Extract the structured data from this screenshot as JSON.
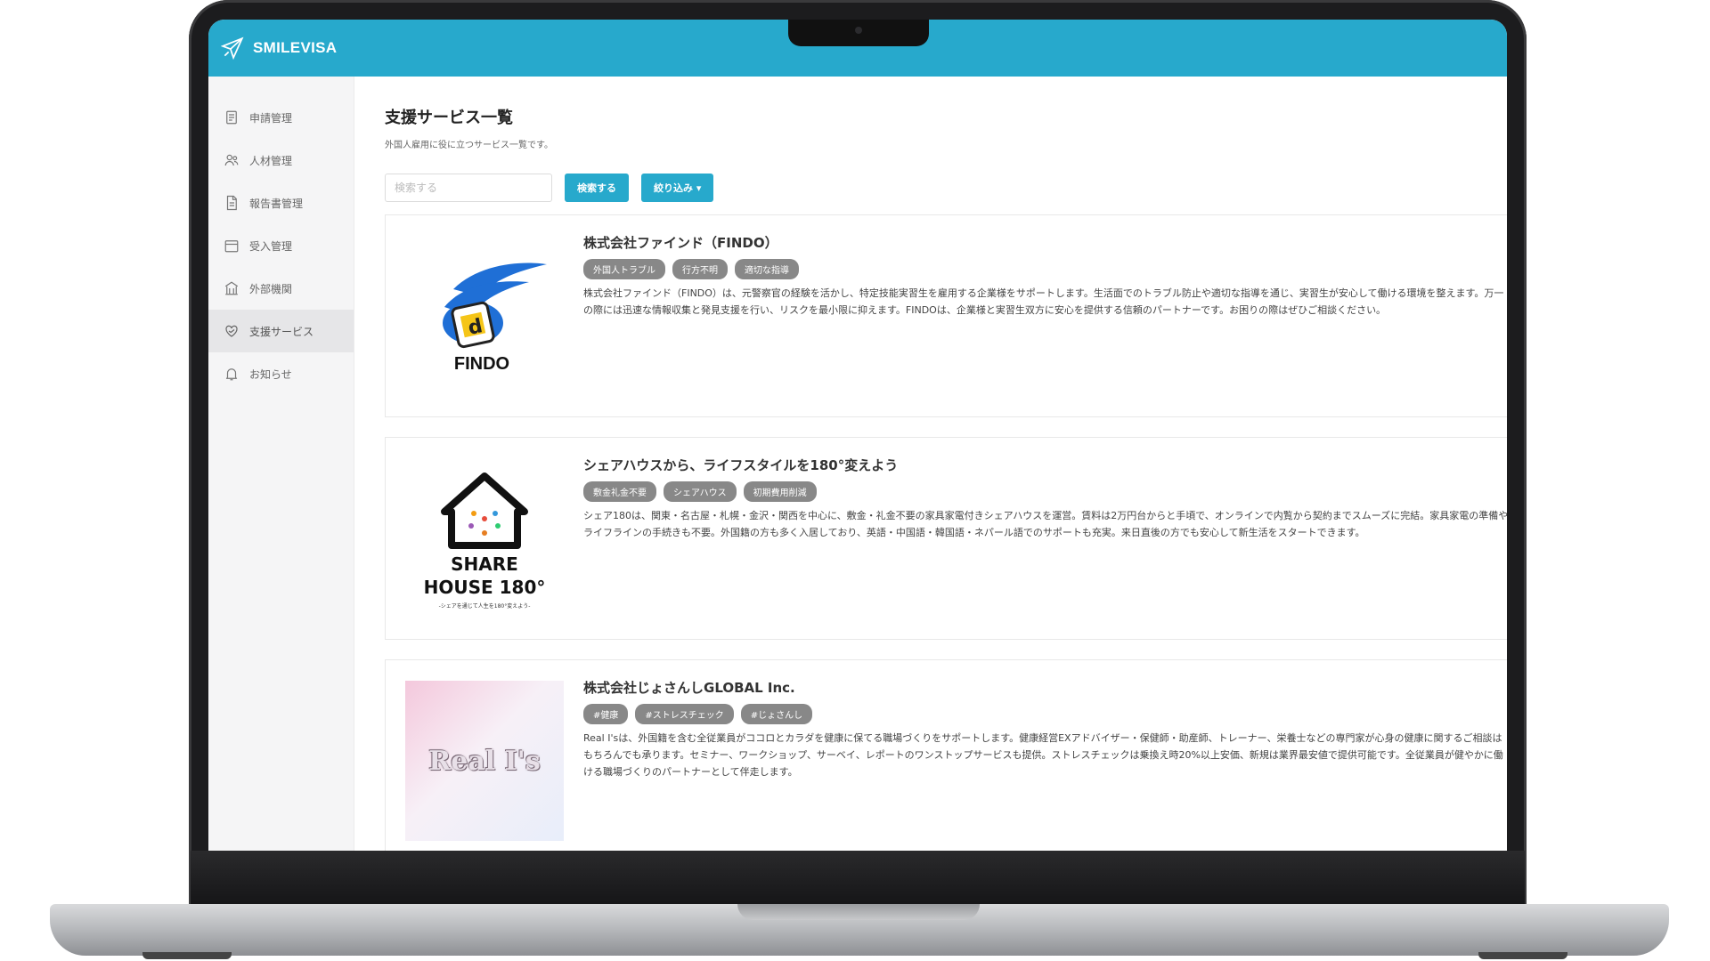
{
  "app": {
    "brand": "SMILEVISA"
  },
  "sidebar": {
    "items": [
      {
        "label": "申請管理",
        "icon": "document-icon"
      },
      {
        "label": "人材管理",
        "icon": "users-icon"
      },
      {
        "label": "報告書管理",
        "icon": "report-icon"
      },
      {
        "label": "受入管理",
        "icon": "calendar-icon"
      },
      {
        "label": "外部機関",
        "icon": "building-icon"
      },
      {
        "label": "支援サービス",
        "icon": "heart-hand-icon",
        "active": true
      },
      {
        "label": "お知らせ",
        "icon": "bell-icon"
      }
    ]
  },
  "main": {
    "title": "支援サービス一覧",
    "subtitle": "外国人雇用に役に立つサービス一覧です。",
    "search": {
      "placeholder": "検索する",
      "value": ""
    },
    "search_button": "検索する",
    "filter_button": "絞り込み ▾",
    "cards": [
      {
        "title": "株式会社ファインド（FINDO）",
        "tags": [
          "外国人トラブル",
          "行方不明",
          "適切な指導"
        ],
        "description": "株式会社ファインド（FINDO）は、元警察官の経験を活かし、特定技能実習生を雇用する企業様をサポートします。生活面でのトラブル防止や適切な指導を通じ、実習生が安心して働ける環境を整えます。万一の際には迅速な情報収集と発見支援を行い、リスクを最小限に抑えます。FINDOは、企業様と実習生双方に安心を提供する信頼のパートナーです。お困りの際はぜひご相談ください。",
        "logo_text": "FINDO"
      },
      {
        "title": "シェアハウスから、ライフスタイルを180°変えよう",
        "tags": [
          "敷金礼金不要",
          "シェアハウス",
          "初期費用削減"
        ],
        "description": "シェア180は、関東・名古屋・札幌・金沢・関西を中心に、敷金・礼金不要の家具家電付きシェアハウスを運営。賃料は2万円台からと手頃で、オンラインで内覧から契約までスムーズに完結。家具家電の準備やライフラインの手続きも不要。外国籍の方も多く入居しており、英語・中国語・韓国語・ネパール語でのサポートも充実。来日直後の方でも安心して新生活をスタートできます。",
        "logo_line1": "SHARE",
        "logo_line2": "HOUSE 180°",
        "logo_tagline": "-シェアを通じて人生を180°変えよう-"
      },
      {
        "title": "株式会社じょさんしGLOBAL Inc.",
        "tags": [
          "#健康",
          "#ストレスチェック",
          "#じょさんし"
        ],
        "description": "Real I'sは、外国籍を含む全従業員がココロとカラダを健康に保てる職場づくりをサポートします。健康経営EXアドバイザー・保健師・助産師、トレーナー、栄養士などの専門家が心身の健康に関するご相談はもちろんでも承ります。セミナー、ワークショップ、サーベイ、レポートのワンストップサービスも提供。ストレスチェックは乗換え時20%以上安価、新規は業界最安値で提供可能です。全従業員が健やかに働ける職場づくりのパートナーとして伴走します。",
        "logo_text": "Real I's"
      }
    ]
  },
  "colors": {
    "accent": "#27a9cc",
    "tag": "#888888"
  }
}
